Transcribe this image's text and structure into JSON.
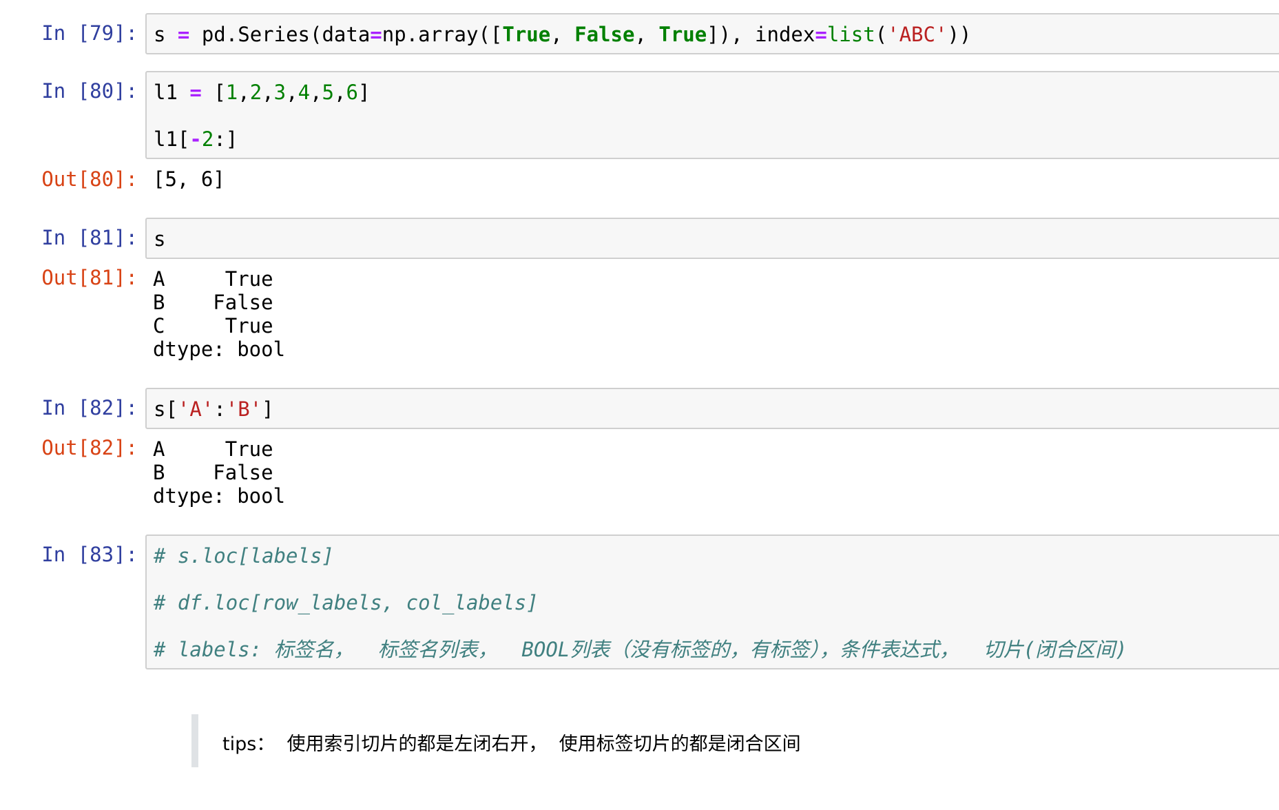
{
  "cells": [
    {
      "prompt": "In [79]:",
      "code": [
        [
          [
            "",
            "s "
          ],
          [
            "op",
            "="
          ],
          [
            "",
            " pd.Series(data"
          ],
          [
            "op",
            "="
          ],
          [
            "",
            "np.array(["
          ],
          [
            "kw",
            "True"
          ],
          [
            "",
            ", "
          ],
          [
            "kw",
            "False"
          ],
          [
            "",
            ", "
          ],
          [
            "kw",
            "True"
          ],
          [
            "",
            "]), index"
          ],
          [
            "op",
            "="
          ],
          [
            "bi",
            "list"
          ],
          [
            "",
            "("
          ],
          [
            "str",
            "'ABC'"
          ],
          [
            "",
            "))"
          ]
        ]
      ]
    },
    {
      "prompt": "In [80]:",
      "code": [
        [
          [
            "",
            "l1 "
          ],
          [
            "op",
            "="
          ],
          [
            "",
            " ["
          ],
          [
            "num",
            "1"
          ],
          [
            "",
            ","
          ],
          [
            "num",
            "2"
          ],
          [
            "",
            ","
          ],
          [
            "num",
            "3"
          ],
          [
            "",
            ","
          ],
          [
            "num",
            "4"
          ],
          [
            "",
            ","
          ],
          [
            "num",
            "5"
          ],
          [
            "",
            ","
          ],
          [
            "num",
            "6"
          ],
          [
            "",
            "]"
          ]
        ],
        [
          [
            "",
            "l1["
          ],
          [
            "op",
            "-"
          ],
          [
            "num",
            "2"
          ],
          [
            "",
            ":]"
          ]
        ]
      ],
      "out_prompt": "Out[80]:",
      "output": [
        "[5, 6]"
      ]
    },
    {
      "prompt": "In [81]:",
      "code": [
        [
          [
            "",
            "s"
          ]
        ]
      ],
      "out_prompt": "Out[81]:",
      "output": [
        "A     True",
        "B    False",
        "C     True",
        "dtype: bool"
      ]
    },
    {
      "prompt": "In [82]:",
      "code": [
        [
          [
            "",
            "s["
          ],
          [
            "str",
            "'A'"
          ],
          [
            "",
            ":"
          ],
          [
            "str",
            "'B'"
          ],
          [
            "",
            "]"
          ]
        ]
      ],
      "out_prompt": "Out[82]:",
      "output": [
        "A     True",
        "B    False",
        "dtype: bool"
      ]
    },
    {
      "prompt": "In [83]:",
      "code": [
        [
          [
            "cm",
            "# s.loc[labels]"
          ]
        ],
        [
          [
            "cm",
            "# df.loc[row_labels, col_labels]"
          ]
        ],
        [
          [
            "cm",
            "# labels: 标签名，  标签名列表，  BOOL列表（没有标签的，有标签），条件表达式，  切片(闭合区间)"
          ]
        ]
      ]
    }
  ],
  "markdown": {
    "tips": "tips：  使用索引切片的都是左闭右开，  使用标签切片的都是闭合区间"
  }
}
